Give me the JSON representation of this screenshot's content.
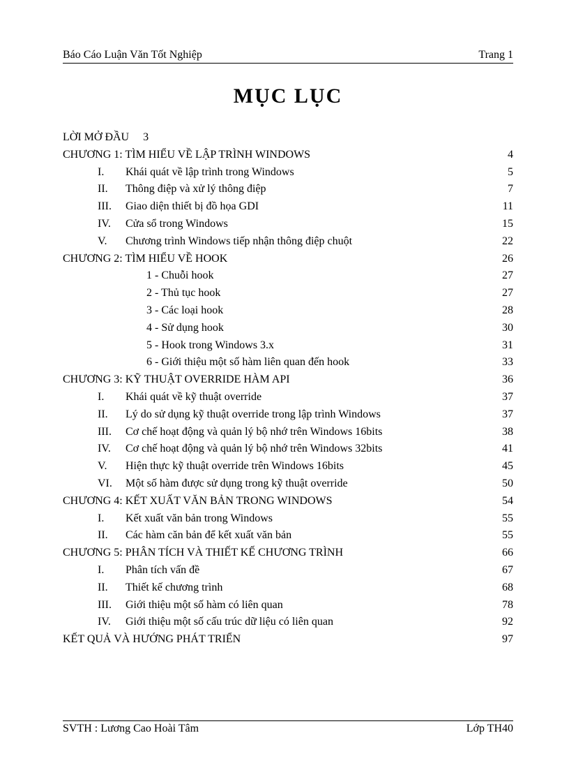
{
  "header": {
    "left": "Báo Cáo Luận Văn Tốt Nghiệp",
    "right": "Trang  1"
  },
  "title": "MỤC  LỤC",
  "intro_label": "LỜI MỞ ĐẦU",
  "intro_page": "3",
  "chapters": [
    {
      "heading": "CHƯƠNG 1: TÌM HIỂU VỀ LẬP TRÌNH WINDOWS",
      "page": "4",
      "items": [
        {
          "num": "I.",
          "label": "Khái quát về lập trình trong Windows",
          "page": "5"
        },
        {
          "num": "II.",
          "label": "Thông điệp và xử lý thông điệp",
          "page": "7"
        },
        {
          "num": "III.",
          "label": "Giao diện thiết bị đồ họa GDI",
          "page": "11"
        },
        {
          "num": "IV.",
          "label": "Cửa sổ trong Windows",
          "page": "15"
        },
        {
          "num": "V.",
          "label": "Chương trình Windows tiếp nhận thông điệp chuột",
          "page": "22"
        }
      ]
    },
    {
      "heading": "CHƯƠNG 2: TÌM HIỂU VỀ HOOK",
      "page": "26",
      "items": [
        {
          "style": "dash",
          "label": "1 - Chuỗi hook",
          "page": "27"
        },
        {
          "style": "dash",
          "label": "2 - Thủ tục hook",
          "page": "27"
        },
        {
          "style": "dash",
          "label": "3 - Các loại hook",
          "page": "28"
        },
        {
          "style": "dash",
          "label": "4 - Sử dụng hook",
          "page": "30"
        },
        {
          "style": "dash",
          "label": "5 - Hook trong Windows 3.x",
          "page": "31"
        },
        {
          "style": "dash",
          "label": "6 - Giới thiệu một số hàm liên quan đến hook",
          "page": "33"
        }
      ]
    },
    {
      "heading": "CHƯƠNG 3: KỸ THUẬT OVERRIDE HÀM API",
      "page": "36",
      "items": [
        {
          "num": "I.",
          "label": "Khái quát về kỹ thuật override",
          "page": "37"
        },
        {
          "num": "II.",
          "label": "Lý do sử dụng kỹ thuật override trong lập trình Windows",
          "page": "37"
        },
        {
          "num": "III.",
          "label": "Cơ chế hoạt động và quản lý bộ nhớ trên Windows 16bits",
          "page": "38"
        },
        {
          "num": "IV.",
          "label": "Cơ chế hoạt động và quản lý bộ nhớ trên Windows 32bits",
          "page": "41"
        },
        {
          "num": "V.",
          "label": "Hiện thực kỹ thuật override trên Windows 16bits",
          "page": "45"
        },
        {
          "num": "VI.",
          "label": "Một số hàm được sử dụng trong kỹ thuật override",
          "page": "50"
        }
      ]
    },
    {
      "heading": "CHƯƠNG 4: KẾT XUẤT VĂN BẢN TRONG WINDOWS",
      "page": "54",
      "items": [
        {
          "num": "I.",
          "label": "Kết xuất văn bản trong Windows",
          "page": "55"
        },
        {
          "num": "II.",
          "label": "Các hàm căn bản để kết xuất văn bản",
          "page": "55"
        }
      ]
    },
    {
      "heading": "CHƯƠNG 5: PHÂN TÍCH VÀ THIẾT KẾ CHƯƠNG TRÌNH",
      "page": "66",
      "items": [
        {
          "num": "I.",
          "label": "Phân tích vấn đề",
          "page": "67"
        },
        {
          "num": "II.",
          "label": "Thiết kế chương trình",
          "page": "68"
        },
        {
          "num": "III.",
          "label": "Giới thiệu một số hàm có liên quan",
          "page": "78"
        },
        {
          "num": "IV.",
          "label": "Giới thiệu một số cấu trúc dữ liệu có liên quan",
          "page": "92"
        }
      ]
    }
  ],
  "conclusion": {
    "label": "KẾT QUẢ VÀ HƯỚNG PHÁT TRIỂN",
    "page": "97"
  },
  "footer": {
    "left": "SVTH : Lương Cao Hoài Tâm",
    "right": "Lớp TH40"
  }
}
